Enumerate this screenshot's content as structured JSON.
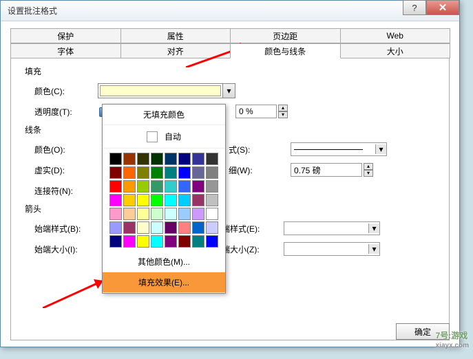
{
  "dialog": {
    "title": "设置批注格式",
    "help": "?",
    "close": "✕"
  },
  "tabs_row1": [
    "保护",
    "属性",
    "页边距",
    "Web"
  ],
  "tabs_row2": [
    "字体",
    "对齐",
    "颜色与线条",
    "大小"
  ],
  "active_tab": "颜色与线条",
  "fill": {
    "section": "填充",
    "color_label": "颜色(C):",
    "transparency_label": "透明度(T):",
    "transparency_value": "0 %"
  },
  "line": {
    "section": "线条",
    "color_label": "颜色(O):",
    "dash_label": "虚实(D):",
    "connector_label": "连接符(N):",
    "style_label": "式(S):",
    "weight_label": "细(W):",
    "weight_value": "0.75 磅"
  },
  "arrows": {
    "section": "箭头",
    "begin_style_label": "始端样式(B):",
    "begin_size_label": "始端大小(I):",
    "end_style_label": "端样式(E):",
    "end_size_label": "端大小(Z):"
  },
  "popup": {
    "no_fill": "无填充颜色",
    "auto": "自动",
    "more_colors": "其他颜色(M)...",
    "fill_effects": "填充效果(E)..."
  },
  "buttons": {
    "ok": "确定"
  },
  "grid_colors": [
    "#000000",
    "#993300",
    "#333300",
    "#003300",
    "#003366",
    "#000080",
    "#333399",
    "#333333",
    "#800000",
    "#ff6600",
    "#808000",
    "#008000",
    "#008080",
    "#0000ff",
    "#666699",
    "#808080",
    "#ff0000",
    "#ff9900",
    "#99cc00",
    "#339966",
    "#33cccc",
    "#3366ff",
    "#800080",
    "#969696",
    "#ff00ff",
    "#ffcc00",
    "#ffff00",
    "#00ff00",
    "#00ffff",
    "#00ccff",
    "#993366",
    "#c0c0c0",
    "#ff99cc",
    "#ffcc99",
    "#ffff99",
    "#ccffcc",
    "#ccffff",
    "#99ccff",
    "#cc99ff",
    "#ffffff",
    "#9999ff",
    "#993366",
    "#ffffcc",
    "#ccffff",
    "#660066",
    "#ff8080",
    "#0066cc",
    "#ccccff",
    "#000080",
    "#ff00ff",
    "#ffff00",
    "#00ffff",
    "#800080",
    "#800000",
    "#008080",
    "#0000ff"
  ],
  "watermark": {
    "main": "7号:游戏",
    "sub": "xiayx.com"
  }
}
